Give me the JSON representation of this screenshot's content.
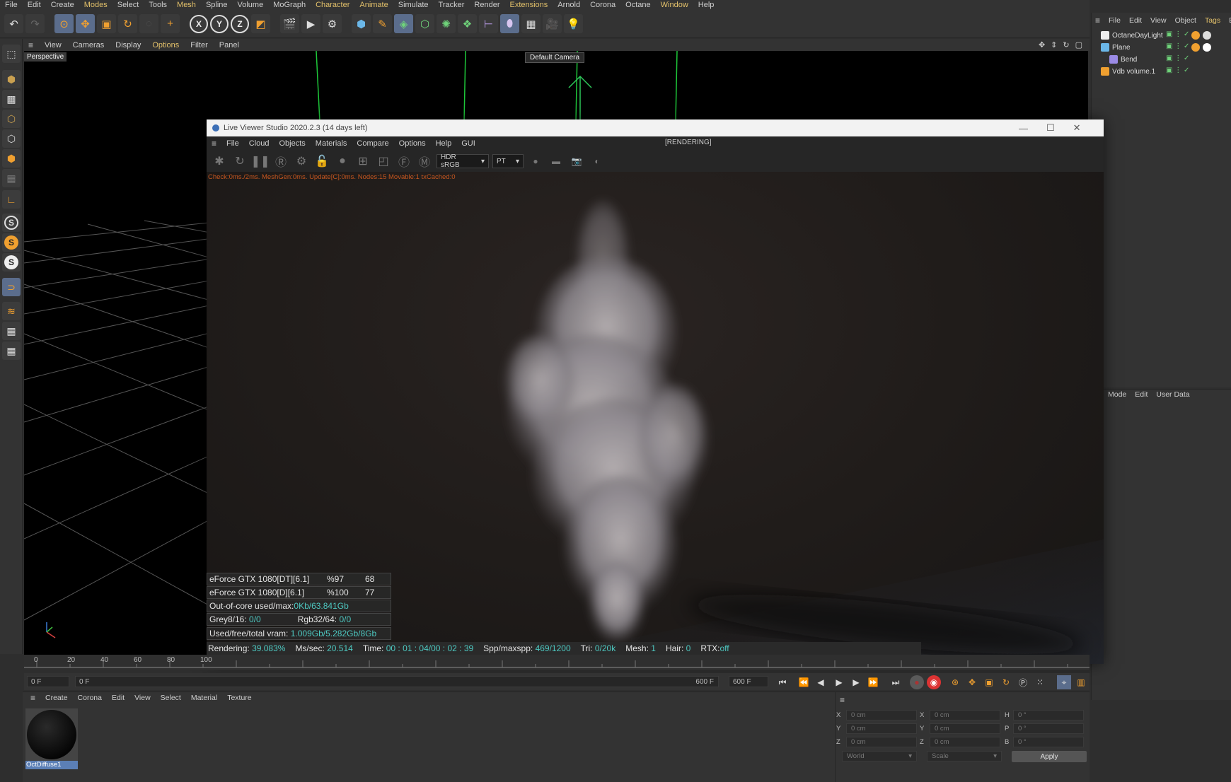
{
  "menubar": [
    "File",
    "Edit",
    "Create",
    "Modes",
    "Select",
    "Tools",
    "Mesh",
    "Spline",
    "Volume",
    "MoGraph",
    "Character",
    "Animate",
    "Simulate",
    "Tracker",
    "Render",
    "Extensions",
    "Arnold",
    "Corona",
    "Octane",
    "Window",
    "Help"
  ],
  "viewport": {
    "menu": [
      "View",
      "Cameras",
      "Display",
      "Options",
      "Filter",
      "Panel"
    ],
    "label": "Perspective",
    "camera": "Default Camera"
  },
  "object_manager": {
    "menu": [
      "File",
      "Edit",
      "View",
      "Object",
      "Tags",
      "Boo"
    ],
    "objects": [
      {
        "name": "OctaneDayLight"
      },
      {
        "name": "Plane"
      },
      {
        "name": "Bend"
      },
      {
        "name": "Vdb volume.1"
      }
    ]
  },
  "attribute_manager": {
    "menu": [
      "Mode",
      "Edit",
      "User Data"
    ]
  },
  "live_viewer": {
    "title": "Live Viewer Studio 2020.2.3 (14 days left)",
    "menu": [
      "File",
      "Cloud",
      "Objects",
      "Materials",
      "Compare",
      "Options",
      "Help",
      "GUI"
    ],
    "status": "[RENDERING]",
    "color_space": "HDR sRGB",
    "kernel": "PT",
    "info": "Check:0ms./2ms. MeshGen:0ms. Update[C]:0ms. Nodes:15 Movable:1 txCached:0",
    "gpus": [
      {
        "name": "eForce GTX 1080[DT][6.1]",
        "util": "%97",
        "temp": "68"
      },
      {
        "name": "eForce GTX 1080[D][6.1]",
        "util": "%100",
        "temp": "77"
      }
    ],
    "out_of_core_label": "Out-of-core used/max:",
    "out_of_core_value": "0Kb/63.841Gb",
    "grey_label": "Grey8/16:",
    "grey_value": "0/0",
    "rgb_label": "Rgb32/64:",
    "rgb_value": "0/0",
    "vram_label": "Used/free/total vram:",
    "vram_value": "1.009Gb/5.282Gb/8Gb",
    "render_bar": {
      "rendering_label": "Rendering:",
      "rendering_value": "39.083%",
      "mssec_label": "Ms/sec:",
      "mssec_value": "20.514",
      "time_label": "Time:",
      "time_value": "00 : 01 : 04/00 : 02 : 39",
      "spp_label": "Spp/maxspp:",
      "spp_value": "469/1200",
      "tri_label": "Tri:",
      "tri_value": "0/20k",
      "mesh_label": "Mesh:",
      "mesh_value": "1",
      "hair_label": "Hair:",
      "hair_value": "0",
      "rtx_label": "RTX:",
      "rtx_value": "off"
    },
    "progress_fraction": 0.39083
  },
  "timeline": {
    "ticks": [
      "0",
      "20",
      "40",
      "60",
      "80",
      "100"
    ],
    "start_field": "0 F",
    "current_field": "0 F",
    "end_field_1": "600 F",
    "end_field_2": "600 F"
  },
  "material_manager": {
    "menu": [
      "Create",
      "Corona",
      "Edit",
      "View",
      "Select",
      "Material",
      "Texture"
    ],
    "material_name": "OctDiffuse1"
  },
  "coordinates": {
    "rows": [
      {
        "a": "X",
        "av": "0 cm",
        "b": "X",
        "bv": "0 cm",
        "c": "H",
        "cv": "0 °"
      },
      {
        "a": "Y",
        "av": "0 cm",
        "b": "Y",
        "bv": "0 cm",
        "c": "P",
        "cv": "0 °"
      },
      {
        "a": "Z",
        "av": "0 cm",
        "b": "Z",
        "bv": "0 cm",
        "c": "B",
        "cv": "0 °"
      }
    ],
    "space": "World",
    "mode": "Scale",
    "apply": "Apply"
  }
}
